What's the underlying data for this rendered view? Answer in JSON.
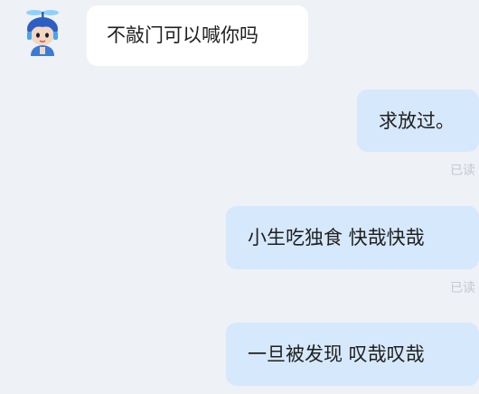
{
  "conversation": {
    "incoming": [
      {
        "text": "不敲门可以喊你吗"
      }
    ],
    "outgoing": [
      {
        "text": "求放过。",
        "status": "已读"
      },
      {
        "text": "小生吃独食 快哉快哉",
        "status": "已读"
      },
      {
        "text": "一旦被发现 叹哉叹哉"
      }
    ]
  },
  "colors": {
    "background": "#eef1f6",
    "incoming_bubble": "#ffffff",
    "outgoing_bubble": "#d6e8fb",
    "read_status": "#c4c8cf",
    "avatar_accent": "#3a7bd5"
  },
  "icons": {
    "avatar": "boy-with-propeller-cap-avatar"
  }
}
